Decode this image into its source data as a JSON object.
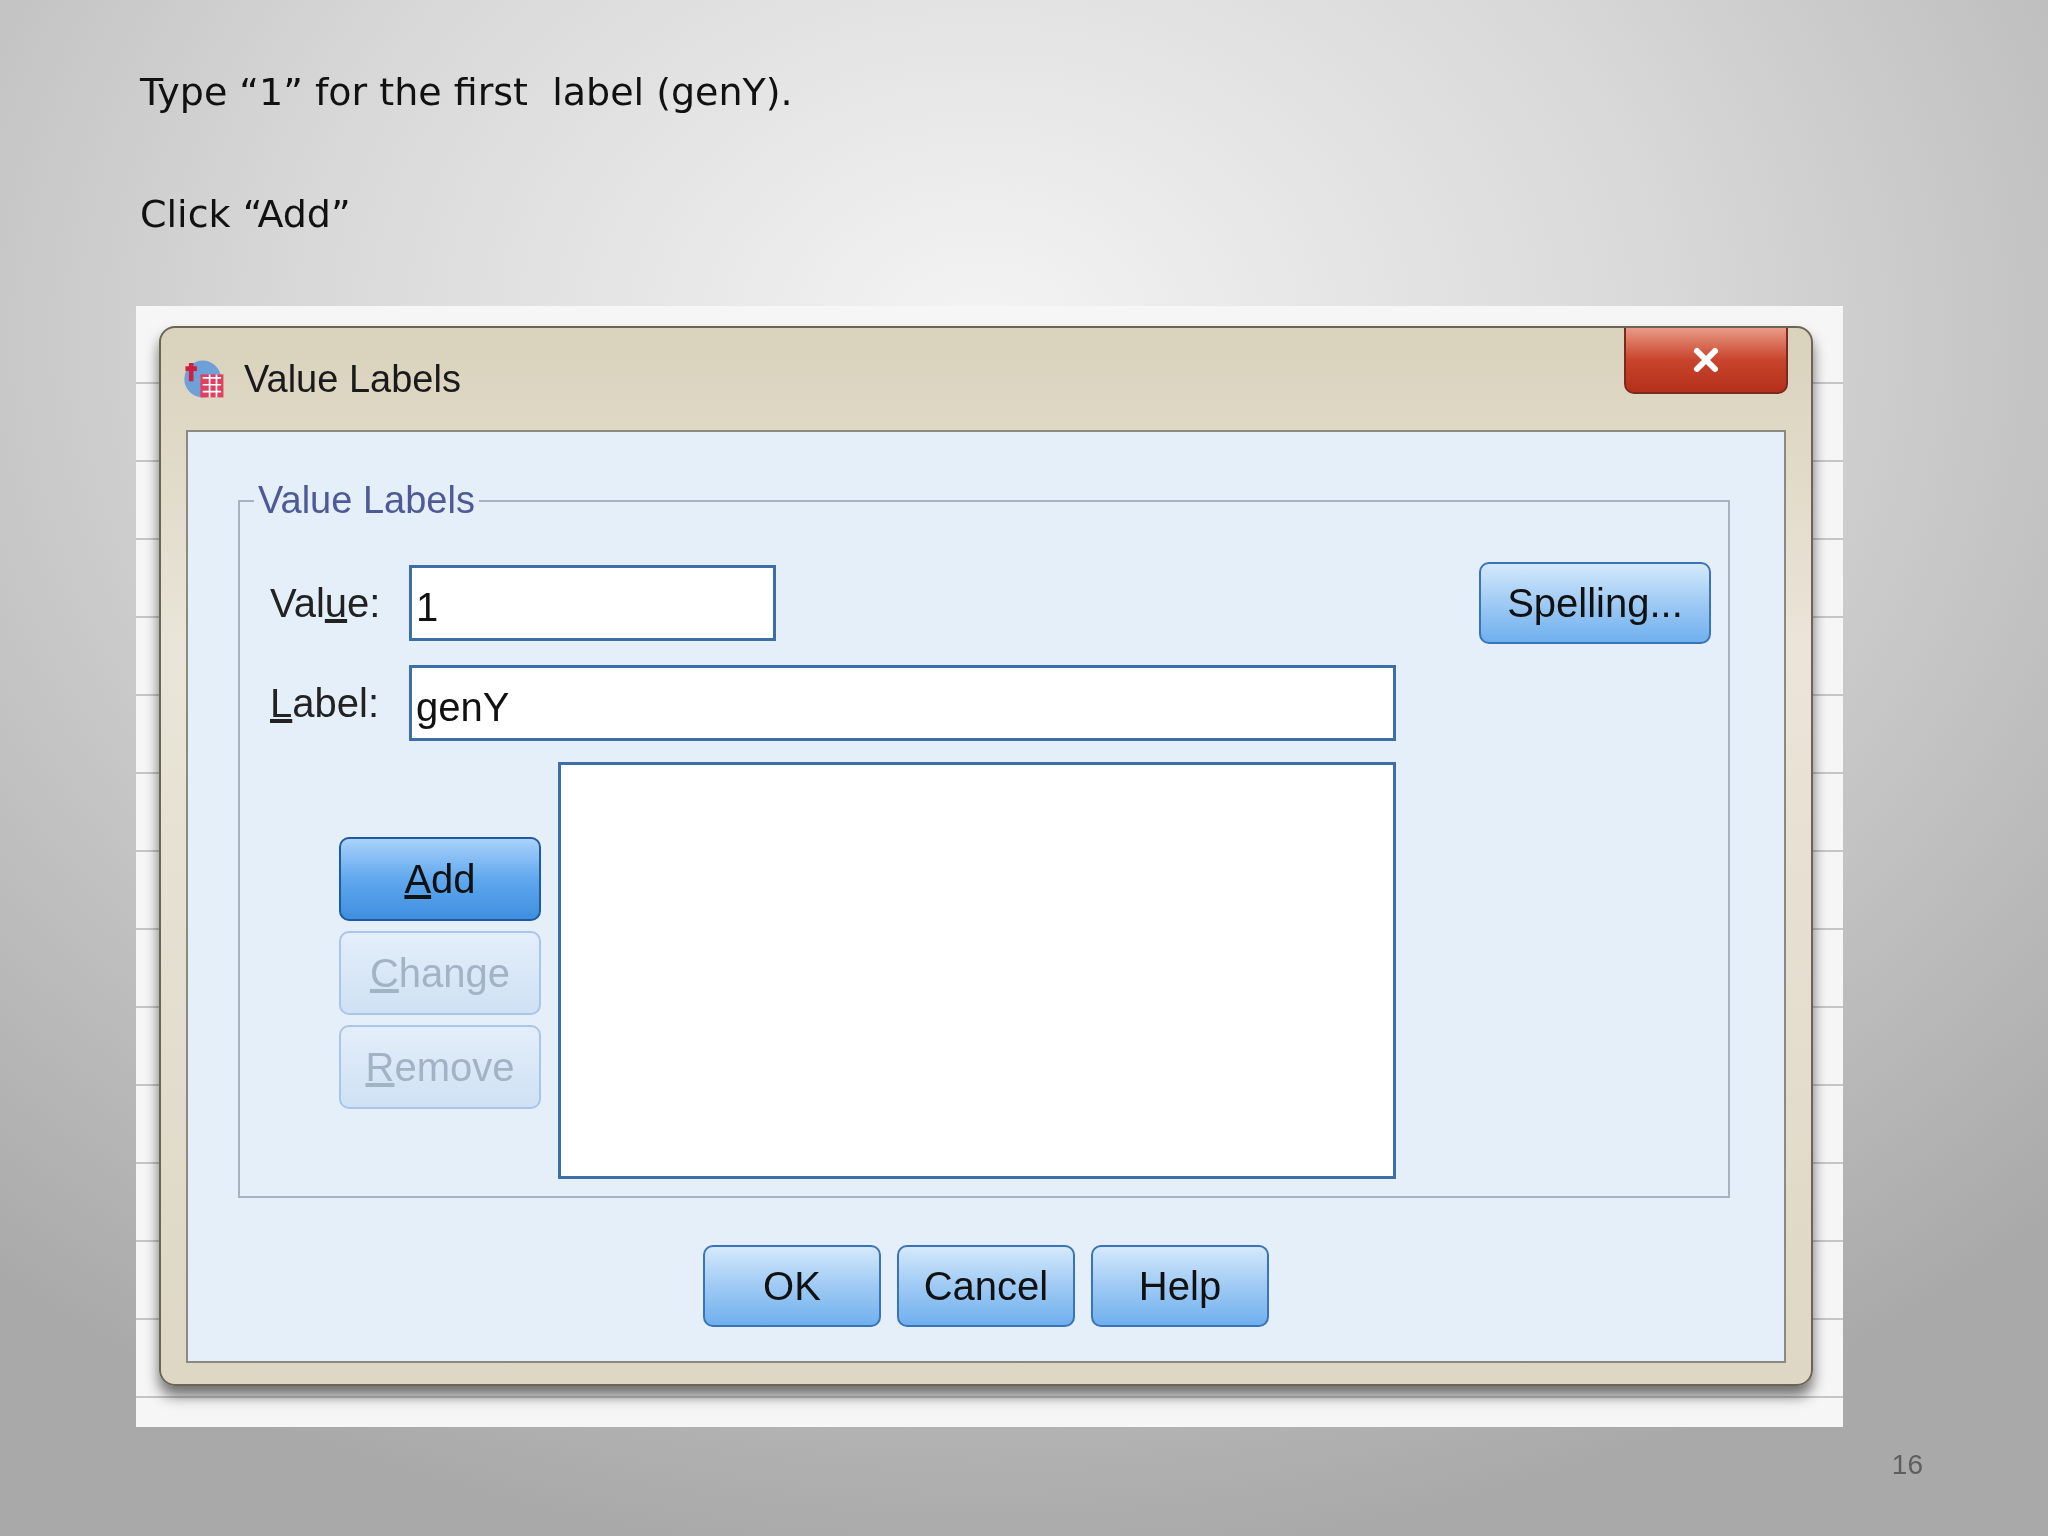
{
  "slide": {
    "instructions": [
      "Type “1” for the first  label (genY).",
      "Click “Add”"
    ],
    "page_number": "16"
  },
  "dialog": {
    "title": "Value Labels",
    "group_title": "Value Labels",
    "fields": [
      {
        "kind": "short",
        "label": {
          "before": "Val",
          "key": "u",
          "after": "e:"
        },
        "value": "1"
      },
      {
        "kind": "long",
        "label": {
          "key": "L",
          "after": "abel:"
        },
        "value": "genY"
      }
    ],
    "spelling_button": "Spelling...",
    "side_buttons": [
      {
        "label": {
          "key": "A",
          "after": "dd"
        },
        "disabled": false,
        "focused": true
      },
      {
        "label": {
          "key": "C",
          "after": "hange"
        },
        "disabled": true,
        "focused": false
      },
      {
        "label": {
          "key": "R",
          "after": "emove"
        },
        "disabled": true,
        "focused": false
      }
    ],
    "footer_buttons": [
      "OK",
      "Cancel",
      "Help"
    ]
  }
}
